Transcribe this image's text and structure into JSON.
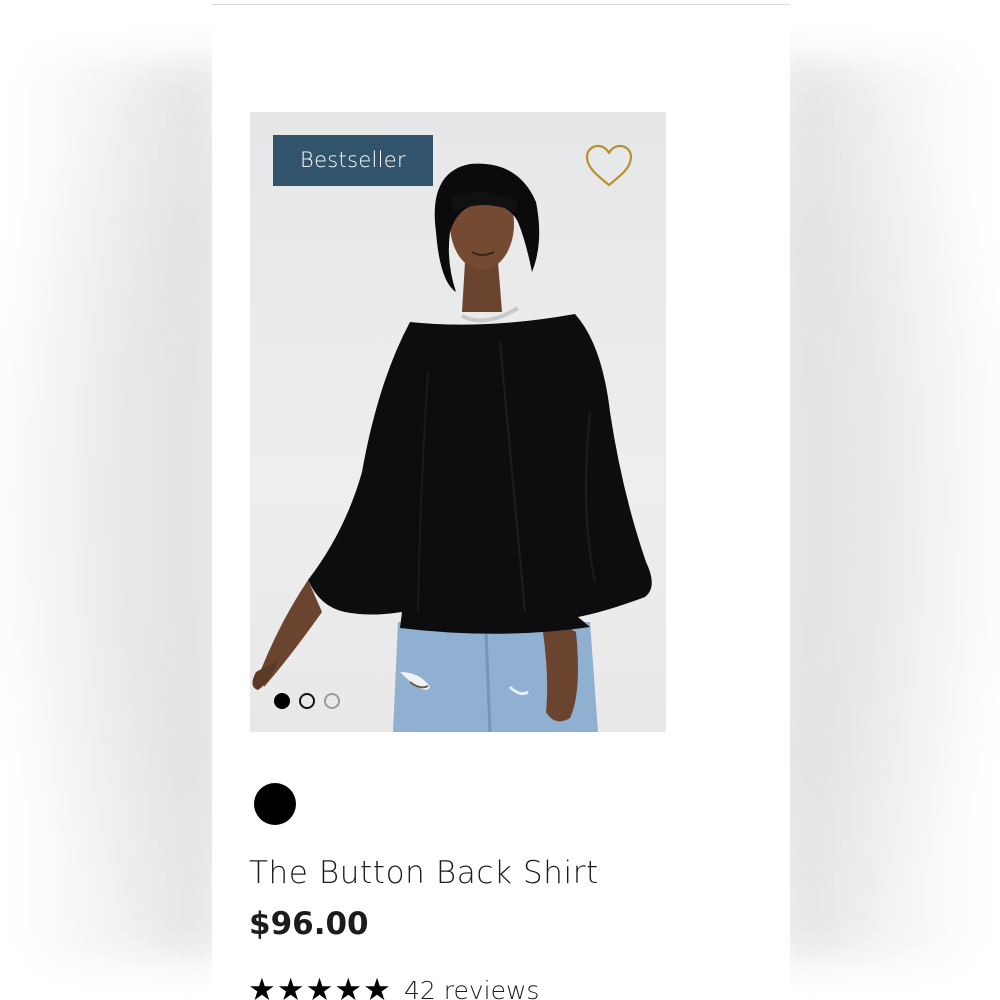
{
  "product": {
    "badge": "Bestseller",
    "title": "The Button Back Shirt",
    "price": "$96.00",
    "rating": {
      "stars": 5,
      "stars_glyphs": "★★★★★",
      "reviews_label": "42 reviews"
    },
    "swatch_color": "#000000",
    "image_carousel": {
      "count": 3,
      "active_index": 0
    }
  },
  "icons": {
    "wishlist": "heart-outline-icon",
    "wishlist_color": "#b8902f"
  },
  "colors": {
    "badge_background": "#32536c",
    "badge_text": "#ffffff"
  }
}
